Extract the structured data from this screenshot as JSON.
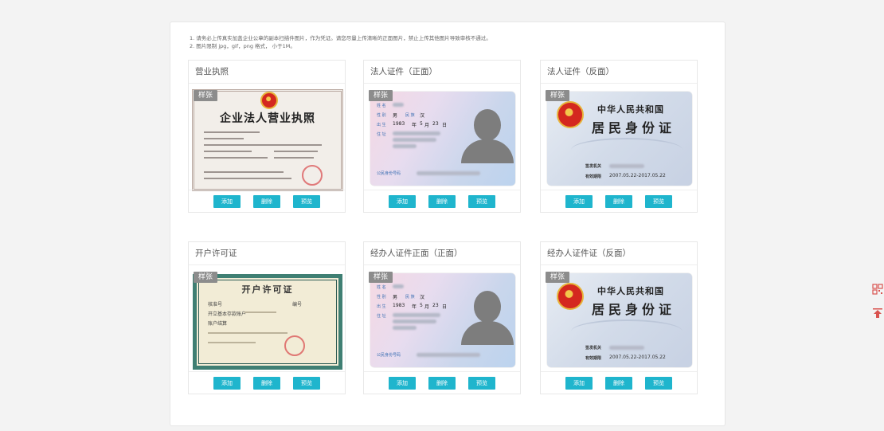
{
  "notes": {
    "line1": "1. 请务必上传真实加盖企业公章的副本扫描件图片，作为凭证。请您尽量上传清晰的正面图片，禁止上传其他图片导致审核不通过。",
    "line2": "2. 图片限制 jpg，gif，png 格式， 小于1M。"
  },
  "sample_label": "样张",
  "buttons": {
    "add": "添加",
    "delete": "删除",
    "preview": "预览"
  },
  "cards": [
    {
      "title": "营业执照",
      "kind": "license"
    },
    {
      "title": "法人证件（正面）",
      "kind": "id-front"
    },
    {
      "title": "法人证件（反面）",
      "kind": "id-back"
    },
    {
      "title": "开户许可证",
      "kind": "permit"
    },
    {
      "title": "经办人证件正面（正面）",
      "kind": "id-front"
    },
    {
      "title": "经办人证件证（反面）",
      "kind": "id-back"
    }
  ],
  "license": {
    "title": "企业法人营业执照"
  },
  "id_front": {
    "name_label": "姓 名",
    "sex_label": "性 别",
    "sex": "男",
    "nation_label": "民 族",
    "nation": "汉",
    "birth_label": "出 生",
    "birth_year": "1983",
    "year_unit": "年",
    "birth_month": "5",
    "month_unit": "月",
    "birth_day": "23",
    "day_unit": "日",
    "addr_label": "住 址",
    "idno_label": "公民身份号码"
  },
  "id_back": {
    "title1": "中华人民共和国",
    "title2": "居民身份证",
    "authority_label": "签发机关",
    "valid_label": "有效期限",
    "valid": "2007.05.22-2017.05.22"
  },
  "permit": {
    "title": "开户许可证",
    "t1": "核准号",
    "t2": "开立基本存款账户",
    "t3": "账户结算",
    "t4": "编号"
  },
  "side": {
    "qr_icon": "qr-code-icon",
    "top_icon": "back-to-top-icon"
  },
  "colors": {
    "button": "#1fb5cd",
    "sample_badge": "#8c8c8c",
    "side_icon": "#d9534f"
  }
}
